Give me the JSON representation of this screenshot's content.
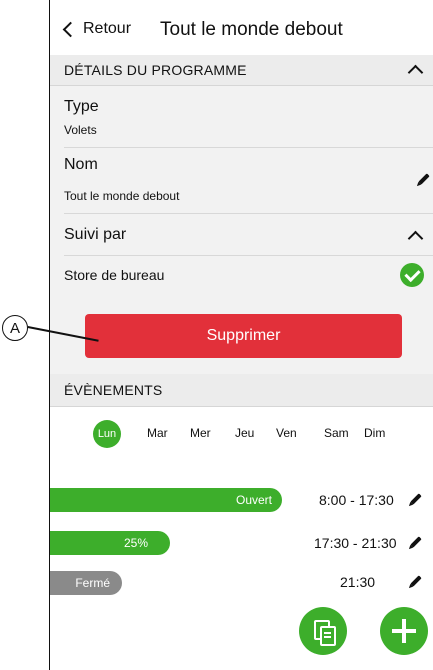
{
  "header": {
    "back_label": "Retour",
    "title": "Tout le monde debout"
  },
  "details": {
    "section_title": "DÉTAILS DU PROGRAMME",
    "type_label": "Type",
    "type_value": "Volets",
    "name_label": "Nom",
    "name_value": "Tout le monde debout",
    "followed_label": "Suivi par",
    "followed_item": "Store de bureau"
  },
  "delete_button": "Supprimer",
  "events": {
    "section_title": "ÉVÈNEMENTS",
    "days": [
      "Lun",
      "Mar",
      "Mer",
      "Jeu",
      "Ven",
      "Sam",
      "Dim"
    ],
    "selected_day": "Lun",
    "items": [
      {
        "bar_label": "Ouvert",
        "time": "8:00 - 17:30",
        "color": "#3dae2b"
      },
      {
        "bar_label": "25%",
        "time": "17:30 - 21:30",
        "color": "#3dae2b"
      },
      {
        "bar_label": "Fermé",
        "time": "21:30",
        "color": "#8a8a8a"
      }
    ]
  },
  "callout": "A",
  "colors": {
    "accent": "#3dae2b",
    "danger": "#e2303a",
    "section_bg": "#ececec",
    "row_bg": "#f2f2f2"
  }
}
